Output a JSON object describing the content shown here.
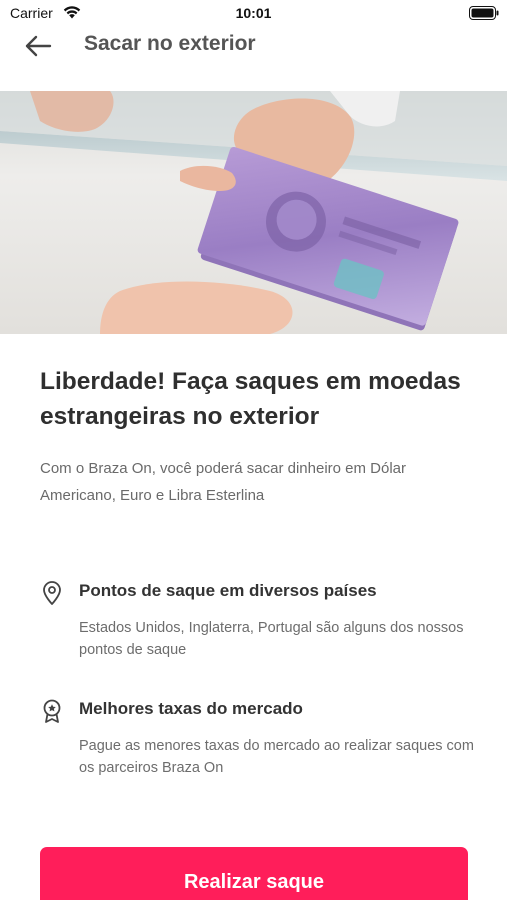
{
  "status_bar": {
    "carrier": "Carrier",
    "time": "10:01",
    "wifi_icon": "wifi-icon",
    "battery_icon": "battery-icon"
  },
  "header": {
    "title": "Sacar no exterior",
    "back_icon": "arrow-left-icon"
  },
  "hero": {
    "image_subject": "hand-exchanging-banknotes"
  },
  "main": {
    "headline": "Liberdade! Faça saques em moedas estrangeiras no exterior",
    "intro": "Com o Braza On, você poderá sacar dinheiro em Dólar Americano, Euro e Libra Esterlina"
  },
  "features": [
    {
      "icon": "location-pin-icon",
      "title": "Pontos de saque em diversos países",
      "description": "Estados Unidos, Inglaterra, Portugal são alguns dos nossos pontos de saque"
    },
    {
      "icon": "award-badge-icon",
      "title": "Melhores taxas do mercado",
      "description": "Pague as menores taxas do mercado ao realizar saques com os parceiros Braza On"
    }
  ],
  "cta": {
    "label": "Realizar saque"
  },
  "colors": {
    "accent": "#ff1e5a",
    "text_dark": "#2f2f2f",
    "text_muted": "#6a6a6a"
  }
}
